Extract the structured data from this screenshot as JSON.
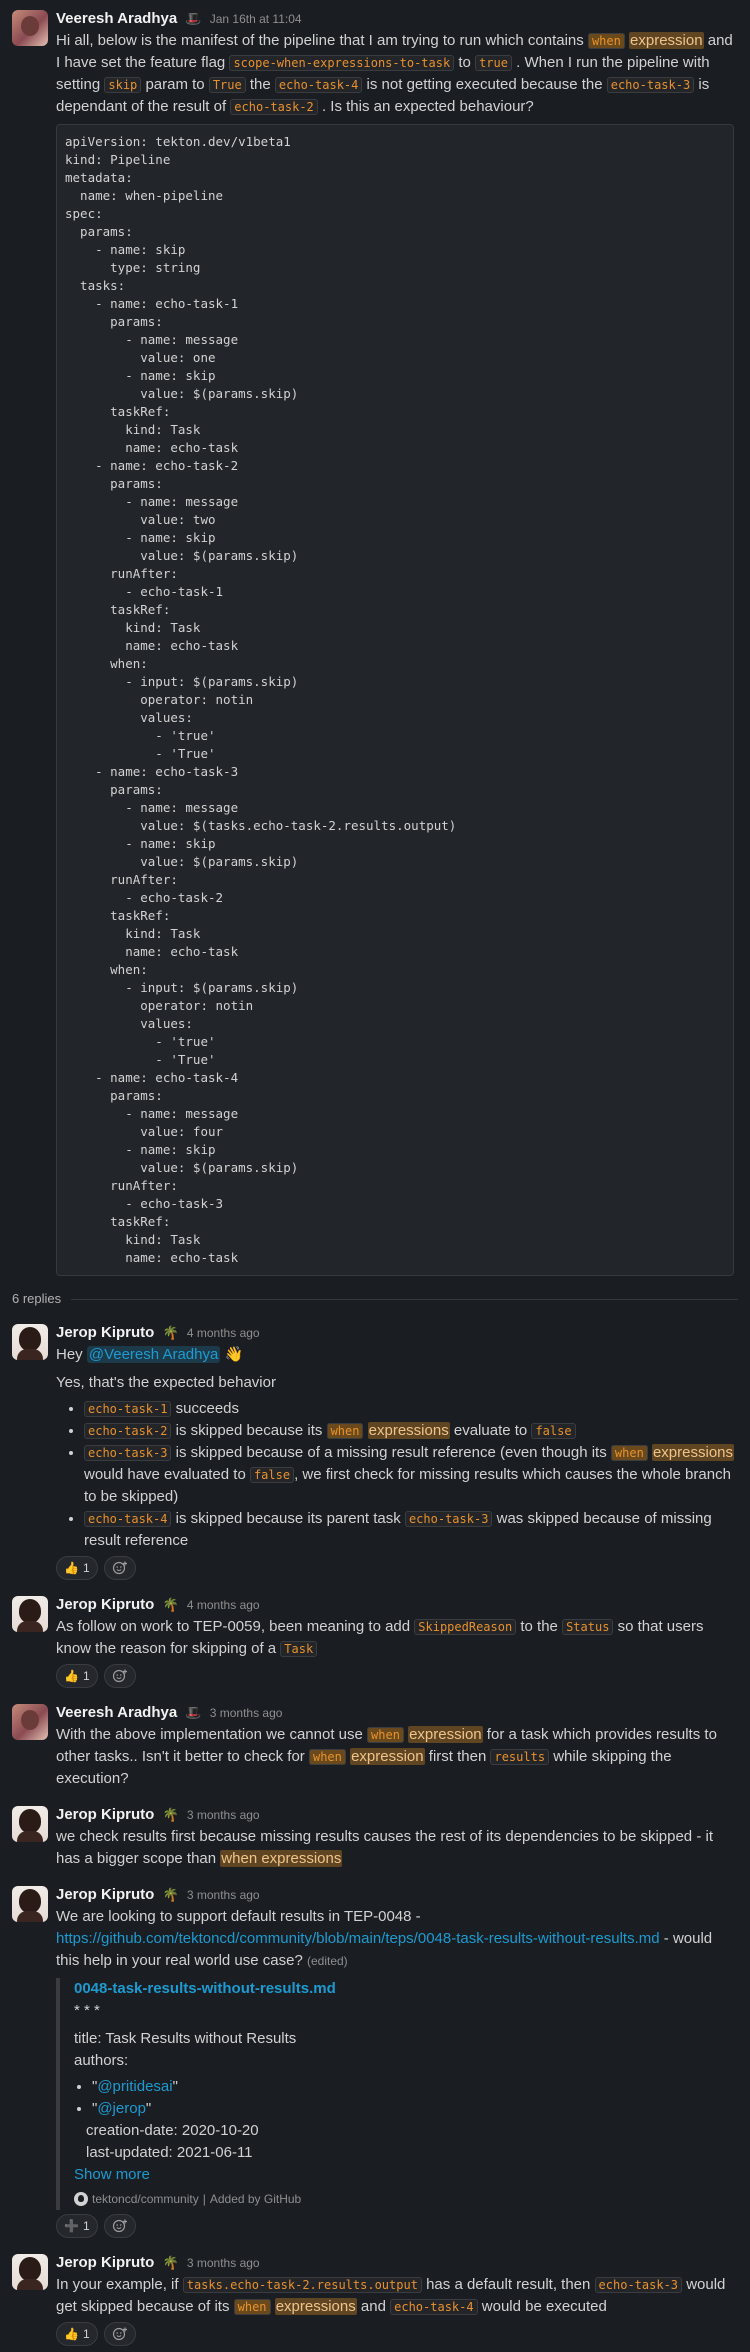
{
  "thread": {
    "parent": {
      "author": "Veeresh Aradhya",
      "status_emoji": "🎩",
      "time": "Jan 16th at 11:04",
      "t1": "Hi all, below is the manifest of  the pipeline that I am trying to run which contains ",
      "h1a": "when",
      "h1b": "expression",
      "t2": " and I have set the feature flag ",
      "c1": "scope-when-expressions-to-task",
      "t3": " to ",
      "c2": "true",
      "t4": " . When I run the pipeline with setting ",
      "c3": "skip",
      "t5": " param to ",
      "c4": "True",
      "t6": " the ",
      "c5": "echo-task-4",
      "t7": " is not getting executed because the ",
      "c6": "echo-task-3",
      "t8": " is dependant of the result of ",
      "c7": "echo-task-2",
      "t9": " . Is this an expected behaviour?",
      "code": "apiVersion: tekton.dev/v1beta1\nkind: Pipeline\nmetadata:\n  name: when-pipeline\nspec:\n  params:\n    - name: skip\n      type: string\n  tasks:\n    - name: echo-task-1\n      params:\n        - name: message\n          value: one\n        - name: skip\n          value: $(params.skip)\n      taskRef:\n        kind: Task\n        name: echo-task\n    - name: echo-task-2\n      params:\n        - name: message\n          value: two\n        - name: skip\n          value: $(params.skip)\n      runAfter:\n        - echo-task-1\n      taskRef:\n        kind: Task\n        name: echo-task\n      when:\n        - input: $(params.skip)\n          operator: notin\n          values:\n            - 'true'\n            - 'True'\n    - name: echo-task-3\n      params:\n        - name: message\n          value: $(tasks.echo-task-2.results.output)\n        - name: skip\n          value: $(params.skip)\n      runAfter:\n        - echo-task-2\n      taskRef:\n        kind: Task\n        name: echo-task\n      when:\n        - input: $(params.skip)\n          operator: notin\n          values:\n            - 'true'\n            - 'True'\n    - name: echo-task-4\n      params:\n        - name: message\n          value: four\n        - name: skip\n          value: $(params.skip)\n      runAfter:\n        - echo-task-3\n      taskRef:\n        kind: Task\n        name: echo-task"
    },
    "replies_label": "6 replies",
    "r1": {
      "author": "Jerop Kipruto",
      "status_emoji": "🌴",
      "time": "4 months ago",
      "hey": "Hey ",
      "mention": "@Veeresh Aradhya",
      "wave": "👋",
      "p2": "Yes, that's the expected behavior",
      "b1c": "echo-task-1",
      "b1t": " succeeds",
      "b2c": "echo-task-2",
      "b2t": " is skipped because its ",
      "b2h1": "when",
      "b2h2": "expressions",
      "b2t2": " evaluate to ",
      "b2c2": "false",
      "b3c": "echo-task-3",
      "b3t": " is skipped because of a missing result reference (even though its ",
      "b3h1": "when",
      "b3h2": "expressions",
      "b3t2": " would have evaluated to ",
      "b3c2": "false",
      "b3t3": ", we first check for missing results which causes the whole branch to be skipped)",
      "b4c": "echo-task-4",
      "b4t": " is skipped because its parent task ",
      "b4c2": "echo-task-3",
      "b4t2": " was skipped because of missing result reference",
      "react_emoji": "👍",
      "react_count": "1",
      "add_icon": "add-reaction-icon"
    },
    "r2": {
      "author": "Jerop Kipruto",
      "status_emoji": "🌴",
      "time": "4 months ago",
      "t1": "As follow on work to TEP-0059, been meaning to add ",
      "c1": "SkippedReason",
      "t2": " to the ",
      "c2": "Status",
      "t3": " so that users know the reason for skipping of a ",
      "c3": "Task",
      "react_emoji": "👍",
      "react_count": "1"
    },
    "r3": {
      "author": "Veeresh Aradhya",
      "status_emoji": "🎩",
      "time": "3 months ago",
      "t1": "With the above implementation we cannot use ",
      "h1a": "when",
      "h1b": "expression",
      "t2": " for a task which provides results to other tasks.. Isn't it better to check for ",
      "h2a": "when",
      "h2b": "expression",
      "t3": " first then ",
      "c1": "results",
      "t4": " while skipping the execution?"
    },
    "r4": {
      "author": "Jerop Kipruto",
      "status_emoji": "🌴",
      "time": "3 months ago",
      "t1": "we check results first because missing results causes the rest of its dependencies to be skipped - it has a bigger scope than ",
      "h1": "when expressions"
    },
    "r5": {
      "author": "Jerop Kipruto",
      "status_emoji": "🌴",
      "time": "3 months ago",
      "t1": "We are looking to support default results in TEP-0048 - ",
      "link": "https://github.com/tektoncd/community/blob/main/teps/0048-task-results-without-results.md",
      "t2": " - would this help in your real world use case?",
      "edited": "(edited)",
      "unfurl": {
        "title": "0048-task-results-without-results.md",
        "sep": "* * *",
        "line_title": "title: Task Results without Results",
        "line_authors": "authors:",
        "auth1_q1": "\"",
        "auth1": "@pritidesai",
        "auth1_q2": "\"",
        "auth2_q1": "\"",
        "auth2": "@jerop",
        "auth2_q2": "\"",
        "created": "creation-date: 2020-10-20",
        "updated": "last-updated: 2021-06-11",
        "show_more": "Show more",
        "source": "tektoncd/community",
        "sep2": "|",
        "added_by": "Added by GitHub"
      },
      "react_emoji": "➕",
      "react_count": "1"
    },
    "r6": {
      "author": "Jerop Kipruto",
      "status_emoji": "🌴",
      "time": "3 months ago",
      "t1": "In your example, if ",
      "c1": "tasks.echo-task-2.results.output",
      "t2": " has a default result, then ",
      "c2": "echo-task-3",
      "t3": " would get skipped because of its ",
      "h1a": "when",
      "h1b": "expressions",
      "t4": " and ",
      "c3": "echo-task-4",
      "t5": " would be executed",
      "react_emoji": "👍",
      "react_count": "1"
    }
  }
}
